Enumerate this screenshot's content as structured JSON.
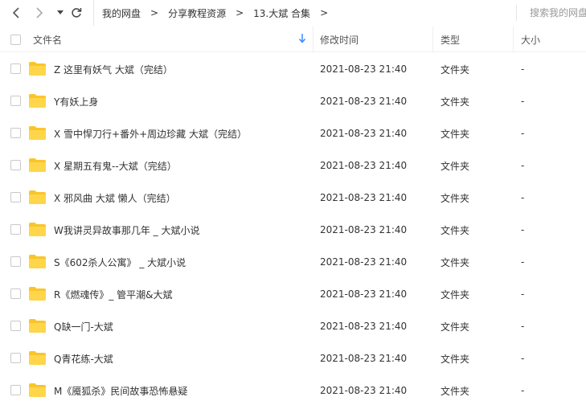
{
  "nav": {
    "back_icon": "chevron-left-icon",
    "forward_icon": "chevron-right-icon",
    "history_icon": "caret-down-icon",
    "refresh_icon": "refresh-icon"
  },
  "breadcrumb": [
    "我的网盘",
    "分享教程资源",
    "13.大斌 合集"
  ],
  "breadcrumb_sep": ">",
  "search": {
    "placeholder": "搜索我的网盘"
  },
  "columns": {
    "name": "文件名",
    "modified": "修改时间",
    "type": "类型",
    "size": "大小"
  },
  "colors": {
    "folder": "#f9c52a",
    "accent": "#3b8cff"
  },
  "files": [
    {
      "name": "Z 这里有妖气  大斌（完结）",
      "modified": "2021-08-23 21:40",
      "type": "文件夹",
      "size": "-"
    },
    {
      "name": "Y有妖上身",
      "modified": "2021-08-23 21:40",
      "type": "文件夹",
      "size": "-"
    },
    {
      "name": "X 雪中悍刀行+番外+周边珍藏  大斌（完结）",
      "modified": "2021-08-23 21:40",
      "type": "文件夹",
      "size": "-"
    },
    {
      "name": "X 星期五有鬼--大斌（完结）",
      "modified": "2021-08-23 21:40",
      "type": "文件夹",
      "size": "-"
    },
    {
      "name": "X 邪风曲  大斌 懒人（完结）",
      "modified": "2021-08-23 21:40",
      "type": "文件夹",
      "size": "-"
    },
    {
      "name": "W我讲灵异故事那几年 _ 大斌小说",
      "modified": "2021-08-23 21:40",
      "type": "文件夹",
      "size": "-"
    },
    {
      "name": "S《602杀人公寓》 _ 大斌小说",
      "modified": "2021-08-23 21:40",
      "type": "文件夹",
      "size": "-"
    },
    {
      "name": "R《燃魂传》_ 管平潮&大斌",
      "modified": "2021-08-23 21:40",
      "type": "文件夹",
      "size": "-"
    },
    {
      "name": "Q缺一门-大斌",
      "modified": "2021-08-23 21:40",
      "type": "文件夹",
      "size": "-"
    },
    {
      "name": "Q青花练-大斌",
      "modified": "2021-08-23 21:40",
      "type": "文件夹",
      "size": "-"
    },
    {
      "name": "M《魇狐杀》民间故事恐怖悬疑",
      "modified": "2021-08-23 21:40",
      "type": "文件夹",
      "size": "-"
    }
  ]
}
